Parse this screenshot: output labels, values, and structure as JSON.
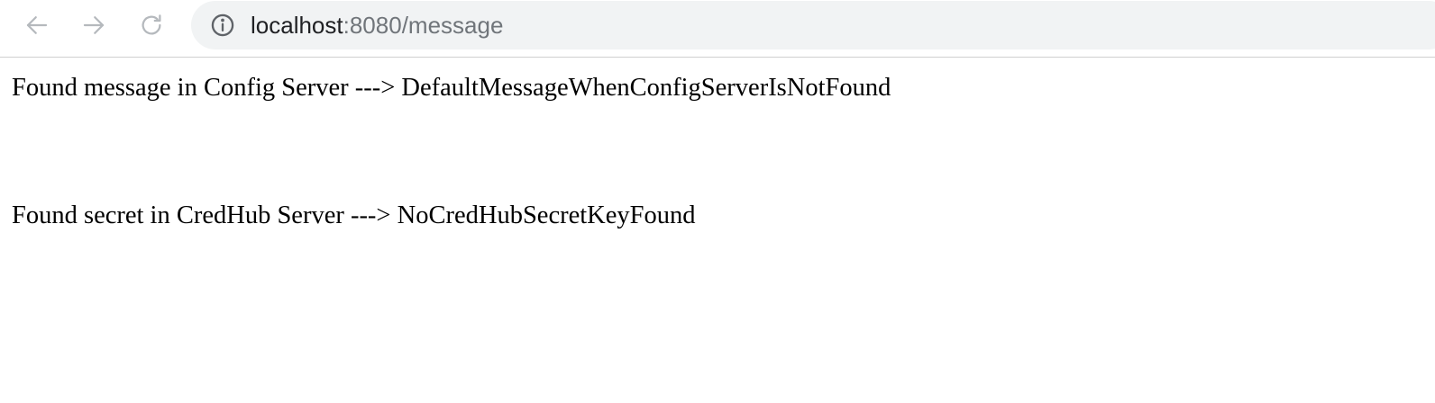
{
  "browser": {
    "url_host": "localhost",
    "url_rest": ":8080/message",
    "icons": {
      "back": "arrow-left-icon",
      "forward": "arrow-right-icon",
      "reload": "reload-icon",
      "site_info": "info-circle-icon"
    },
    "colors": {
      "omnibox_bg": "#f1f3f4",
      "icon_gray": "#9aa0a6",
      "host_text": "#202124",
      "path_text": "#70757a"
    }
  },
  "page": {
    "lines": [
      "Found message in Config Server ---> DefaultMessageWhenConfigServerIsNotFound",
      "Found secret in CredHub Server ---> NoCredHubSecretKeyFound"
    ]
  }
}
